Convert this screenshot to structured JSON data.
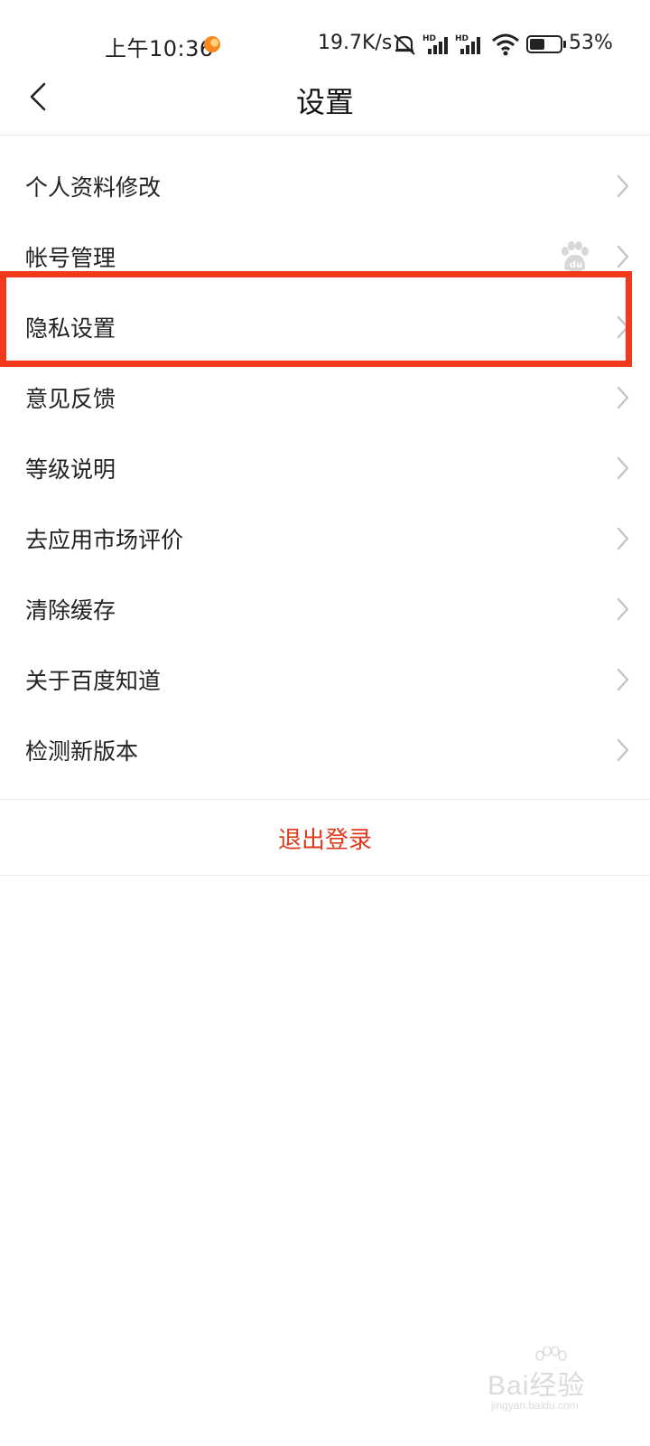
{
  "status_bar": {
    "time": "上午10:36",
    "network_speed": "19.7K/s",
    "battery_percent": "53%",
    "icons": [
      "notification-dot-icon",
      "mute-icon",
      "hd-signal-icon",
      "hd-signal-icon",
      "wifi-icon",
      "battery-icon"
    ]
  },
  "header": {
    "title": "设置",
    "back_icon": "chevron-left-icon"
  },
  "settings": {
    "items": [
      {
        "label": "个人资料修改"
      },
      {
        "label": "帐号管理",
        "extra_icon": "baidu-paw-icon"
      },
      {
        "label": "隐私设置",
        "highlighted": true
      },
      {
        "label": "意见反馈"
      },
      {
        "label": "等级说明"
      },
      {
        "label": "去应用市场评价"
      },
      {
        "label": "清除缓存"
      },
      {
        "label": "关于百度知道"
      },
      {
        "label": "检测新版本"
      }
    ]
  },
  "logout": {
    "label": "退出登录"
  },
  "watermark": {
    "brand": "Bai经验",
    "url": "jingyan.baidu.com"
  },
  "colors": {
    "highlight": "#f2391c",
    "logout_text": "#e0391a",
    "chevron": "#c4c4c4"
  }
}
